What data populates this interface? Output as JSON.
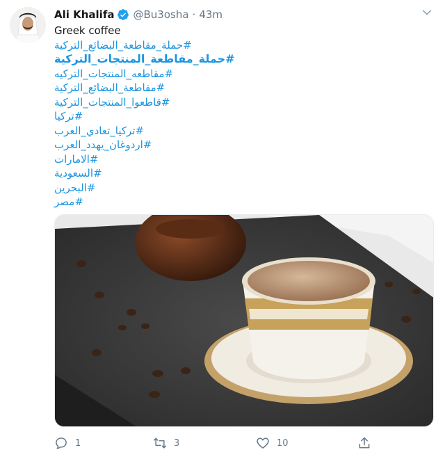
{
  "tweet": {
    "author_name": "Ali Khalifa",
    "handle": "@Bu3osha",
    "separator": "·",
    "time": "43m",
    "caption": "Greek coffee",
    "hashtags": [
      {
        "text": "#حملة_مقاطعة_البضائع_التركية",
        "bold": false
      },
      {
        "text": "#حملة_مقاطعة_المنتجات_التركية",
        "bold": true
      },
      {
        "text": "#مقاطعه_المنتجات_التركيه",
        "bold": false
      },
      {
        "text": "#مقاطعة_البضائع_التركية",
        "bold": false
      },
      {
        "text": "#قاطعوا_المنتجات_التركية",
        "bold": false
      },
      {
        "text": "#تركيا",
        "bold": false
      },
      {
        "text": "#تركيا_تعادي_العرب",
        "bold": false
      },
      {
        "text": "#اردوغان_يهدد_العرب",
        "bold": false
      },
      {
        "text": "#الامارات",
        "bold": false
      },
      {
        "text": "#السعودية",
        "bold": false
      },
      {
        "text": "#البحرين",
        "bold": false
      },
      {
        "text": "#مصر",
        "bold": false
      }
    ],
    "media_description": "cup of coffee on saucer on slate with coffee beans",
    "actions": {
      "reply_count": "1",
      "retweet_count": "3",
      "like_count": "10",
      "share_count": ""
    }
  },
  "icons": {
    "verified": "verified-badge-icon",
    "more": "chevron-down-icon",
    "reply": "reply-icon",
    "retweet": "retweet-icon",
    "like": "heart-icon",
    "share": "share-icon"
  },
  "colors": {
    "accent": "#1b95e0",
    "muted": "#657786",
    "text": "#14171a"
  }
}
